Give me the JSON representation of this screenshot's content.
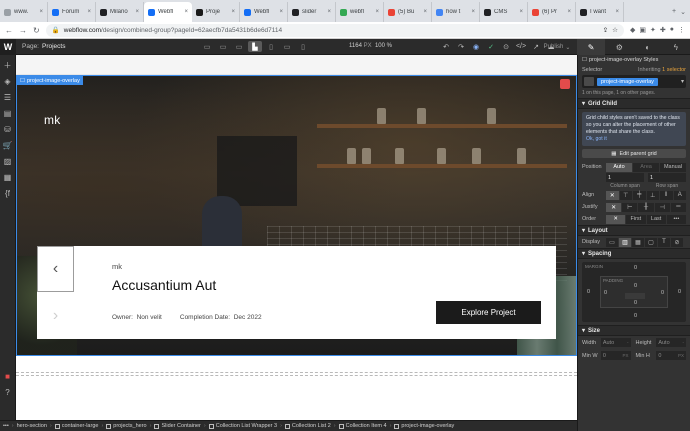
{
  "browser": {
    "tabs": [
      {
        "label": "www.",
        "color": "#9aa0a6",
        "active": false
      },
      {
        "label": "Forum",
        "color": "#146ef5",
        "active": false
      },
      {
        "label": "Milano",
        "color": "#202124",
        "active": false
      },
      {
        "label": "Webfl",
        "color": "#146ef5",
        "active": true
      },
      {
        "label": "Proje",
        "color": "#1a1a1a",
        "active": false
      },
      {
        "label": "Webfl",
        "color": "#146ef5",
        "active": false
      },
      {
        "label": "slider",
        "color": "#202124",
        "active": false
      },
      {
        "label": "webfl",
        "color": "#34a853",
        "active": false
      },
      {
        "label": "(5) Bu",
        "color": "#ea4335",
        "active": false
      },
      {
        "label": "how t",
        "color": "#4285f4",
        "active": false
      },
      {
        "label": "CMS",
        "color": "#202124",
        "active": false
      },
      {
        "label": "(6) Pr",
        "color": "#ea4335",
        "active": false
      },
      {
        "label": "I want",
        "color": "#202124",
        "active": false
      }
    ],
    "url_host": "webflow.com",
    "url_path": "/design/combined-group?pageId=62aecfb7da5431b6de6d7114"
  },
  "designer": {
    "page_label": "Page:",
    "page_name": "Projects",
    "canvas_width": "1164",
    "canvas_unit": "PX",
    "zoom": "100 %",
    "publish_label": "Publish"
  },
  "canvas": {
    "selected_element": "project-image-overlay",
    "hero_logo": "mk",
    "card": {
      "eyebrow": "mk",
      "title": "Accusantium Aut",
      "owner_label": "Owner:",
      "owner_value": "Non velit",
      "completion_label": "Completion Date:",
      "completion_value": "Dec 2022",
      "button_label": "Explore Project"
    }
  },
  "breadcrumb": [
    "hero-section",
    "container-large",
    "projects_hero",
    "Slider Container",
    "Collection List Wrapper 3",
    "Collection List 2",
    "Collection Item 4",
    "project-image-overlay"
  ],
  "panel": {
    "element_title": "project-image-overlay Styles",
    "selector_label": "Selector",
    "inheriting_prefix": "Inheriting",
    "inheriting_count": "1 selector",
    "class_name": "project-image-overlay",
    "usage_note": "1 on this page, 1 on other pages.",
    "grid_child": {
      "title": "Grid Child",
      "info": "Grid child styles aren't saved to the class so you can alter the placement of other elements that share the class.",
      "info_link": "Ok, got it",
      "edit_button": "Edit parent grid",
      "position_label": "Position",
      "position_options": [
        "Auto",
        "Area",
        "Manual"
      ],
      "column_span_value": "1",
      "column_span_label": "Column span",
      "row_span_value": "1",
      "row_span_label": "Row span",
      "align_label": "Align",
      "justify_label": "Justify",
      "order_label": "Order",
      "order_options": [
        "First",
        "Last"
      ]
    },
    "layout": {
      "title": "Layout",
      "display_label": "Display"
    },
    "spacing": {
      "title": "Spacing",
      "margin_label": "MARGIN",
      "padding_label": "PADDING",
      "values": [
        "0",
        "0",
        "0",
        "0",
        "0",
        "0",
        "0",
        "0"
      ]
    },
    "size": {
      "title": "Size",
      "width_label": "Width",
      "width_value": "Auto",
      "height_label": "Height",
      "height_value": "Auto",
      "min_w_label": "Min W",
      "min_w_value": "0",
      "min_h_label": "Min H",
      "min_h_value": "0",
      "unit": "PX"
    }
  }
}
